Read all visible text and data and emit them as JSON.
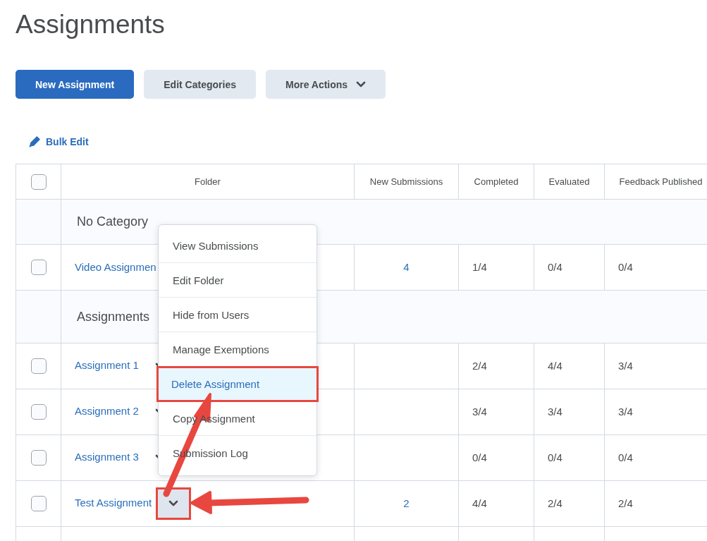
{
  "page": {
    "title": "Assignments"
  },
  "toolbar": [
    {
      "label": "New Assignment",
      "kind": "primary"
    },
    {
      "label": "Edit Categories",
      "kind": "secondary"
    },
    {
      "label": "More Actions",
      "kind": "dropdown"
    }
  ],
  "bulk_edit": {
    "label": "Bulk Edit"
  },
  "table": {
    "select_all": {
      "checked": false
    },
    "columns": [
      "Folder",
      "New Submissions",
      "Completed",
      "Evaluated",
      "Feedback Published"
    ],
    "rows": [
      {
        "kind": "category",
        "label": "No Category"
      },
      {
        "kind": "item",
        "checked": false,
        "name": "Video Assignmen",
        "new_submissions": "4",
        "completed": "1/4",
        "evaluated": "0/4",
        "feedback_published": "0/4"
      },
      {
        "kind": "category",
        "label": "Assignments"
      },
      {
        "kind": "item",
        "checked": false,
        "name": "Assignment 1",
        "actions_selected": false,
        "completed": "2/4",
        "evaluated": "4/4",
        "feedback_published": "3/4"
      },
      {
        "kind": "item",
        "checked": false,
        "name": "Assignment 2",
        "actions_selected": false,
        "completed": "3/4",
        "evaluated": "3/4",
        "feedback_published": "3/4"
      },
      {
        "kind": "item",
        "checked": false,
        "name": "Assignment 3",
        "actions_selected": false,
        "completed": "0/4",
        "evaluated": "0/4",
        "feedback_published": "0/4"
      },
      {
        "kind": "item",
        "checked": false,
        "name": "Test Assignment",
        "actions_selected": true,
        "new_submissions": "2",
        "completed": "4/4",
        "evaluated": "2/4",
        "feedback_published": "2/4"
      }
    ]
  },
  "context_menu": {
    "items": [
      {
        "label": "View Submissions",
        "selected": false
      },
      {
        "label": "Edit Folder",
        "selected": false
      },
      {
        "label": "Hide from Users",
        "selected": false
      },
      {
        "label": "Manage Exemptions",
        "selected": false
      },
      {
        "label": "Delete Assignment",
        "selected": true
      },
      {
        "label": "Copy Assignment",
        "selected": false
      },
      {
        "label": "Submission Log",
        "selected": false
      }
    ]
  }
}
